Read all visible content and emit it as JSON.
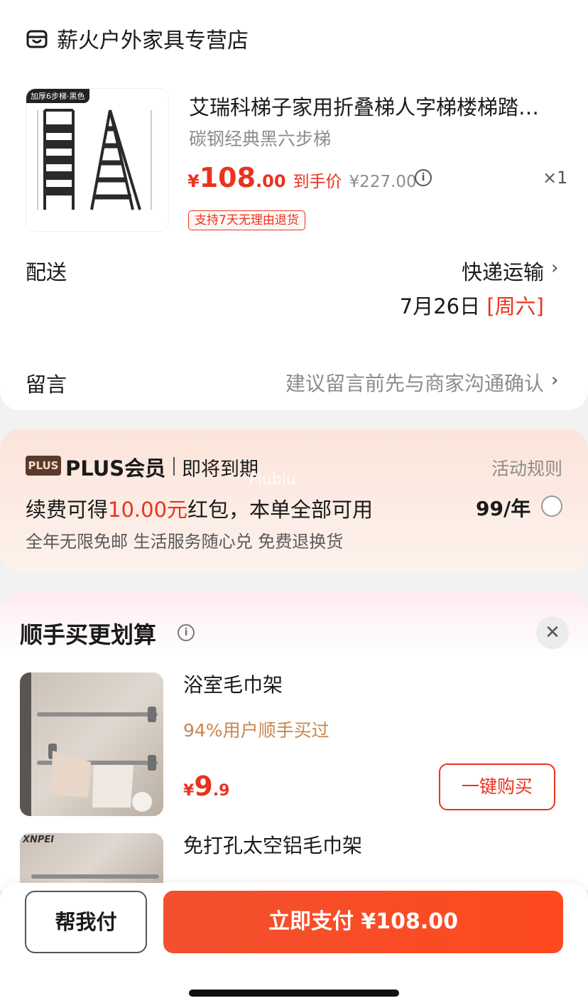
{
  "shop": {
    "name": "薪火户外家具专营店",
    "icon": "shop-icon"
  },
  "product": {
    "image_tag": "加厚6步梯·黑色",
    "title": "艾瑞科梯子家用折叠梯人字梯楼梯踏…",
    "spec": "碳钢经典黑六步梯",
    "price_yen": "¥",
    "price_int": "108",
    "price_dec": ".00",
    "price_label": "到手价",
    "orig_price": "¥227.00",
    "qty": "×1",
    "return_badge": "支持7天无理由退货"
  },
  "delivery": {
    "label": "配送",
    "method": "快递运输",
    "date": "7月26日 ",
    "day": "[周六]"
  },
  "message": {
    "label": "留言",
    "placeholder": "建议留言前先与商家沟通确认"
  },
  "plus": {
    "logo": "PLUS",
    "title": "PLUS会员",
    "status": "即将到期",
    "rules": "活动规则",
    "watermark": "Piubiu",
    "main_pre": "续费可得",
    "main_amt": "10.00元",
    "main_post": "红包，本单全部可用",
    "price": "99/年",
    "benefits": "全年无限免邮 生活服务随心兑 免费退换货"
  },
  "recommend": {
    "title": "顺手买更划算",
    "items": [
      {
        "name": "浴室毛巾架",
        "sub": "94%用户顺手买过",
        "price_yen": "¥",
        "price_int": "9",
        "price_dec": ".9",
        "button": "一键购买"
      },
      {
        "name": "免打孔太空铝毛巾架",
        "brand": "XNPEI"
      }
    ]
  },
  "bottom": {
    "help_label": "帮我付",
    "pay_label": "立即支付 ¥108.00"
  },
  "colors": {
    "accent": "#e9331f",
    "pay_btn": "#fe4a1f",
    "gold_text": "#c8864e"
  }
}
